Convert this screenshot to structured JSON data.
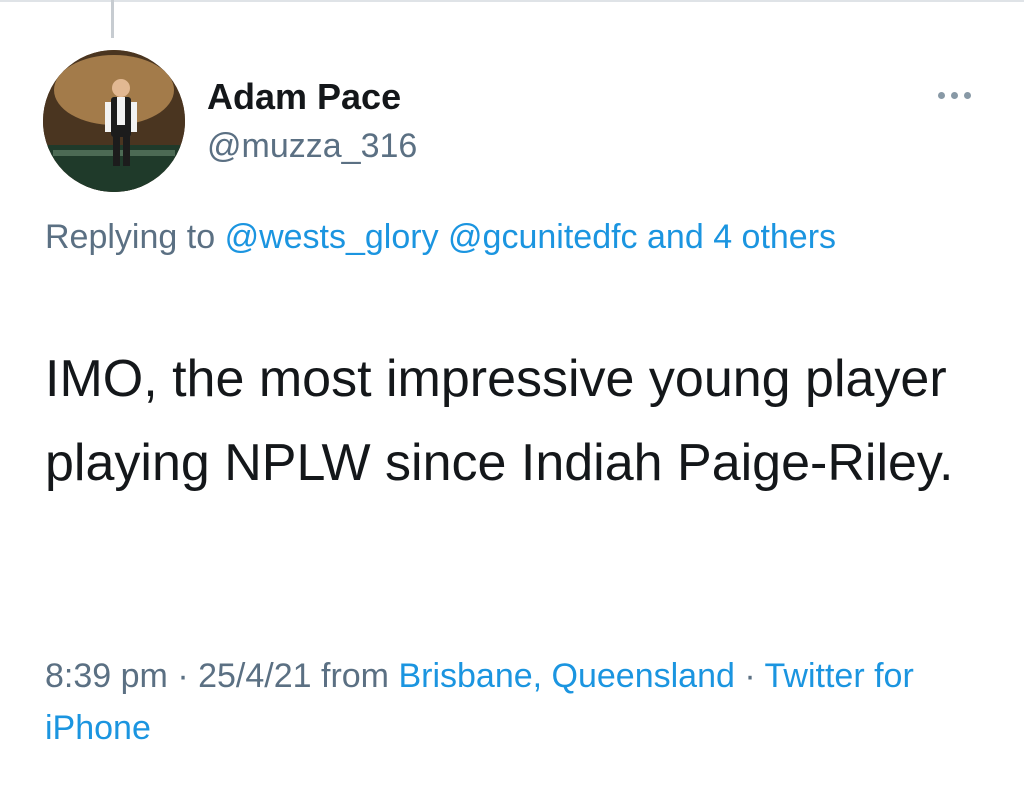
{
  "author": {
    "display_name": "Adam Pace",
    "handle": "@muzza_316"
  },
  "reply": {
    "prefix": "Replying to",
    "mention_1": "@wests_glory",
    "mention_2": "@gcunitedfc",
    "others": "and 4 others"
  },
  "tweet": {
    "text": "IMO, the most impressive young player playing NPLW since Indiah Paige-Riley."
  },
  "meta": {
    "time": "8:39 pm",
    "separator": "·",
    "date": "25/4/21",
    "from_label": "from",
    "location": "Brisbane, Queensland",
    "client": "Twitter for iPhone"
  },
  "icons": {
    "more": "more-options-icon"
  },
  "colors": {
    "text": "#14171a",
    "secondary": "#5b7083",
    "link": "#1b95e0"
  }
}
